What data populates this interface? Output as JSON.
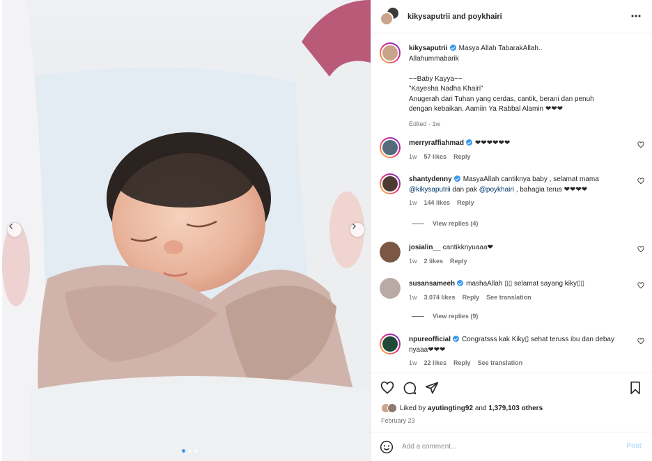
{
  "header": {
    "title": "kikysaputrii and poykhairi"
  },
  "caption": {
    "username": "kikysaputrii",
    "lines": [
      "Masya Allah TabarakAllah..",
      "Allahummabarik",
      "",
      "~~Baby Kayya~~",
      "\"Kayesha Nadha Khairi\"",
      "Anugerah dari Tuhan yang cerdas, cantik, berani dan penuh",
      "dengan kebaikan. Aamiin Ya Rabbal Alamin ❤❤❤"
    ],
    "edited": "Edited · 1w"
  },
  "comments": [
    {
      "username": "merryraffiahmad",
      "verified": true,
      "text": "❤❤❤❤❤❤",
      "time": "1w",
      "likes": "57 likes",
      "reply": "Reply"
    },
    {
      "username": "shantydenny",
      "verified": true,
      "text_1": "MasyaAllah cantiknya baby , selamat mama",
      "mention_1": "@kikysaputrii",
      "text_2": "dan pak",
      "mention_2": "@poykhairi",
      "text_3": ", bahagia terus ❤❤❤❤",
      "time": "1w",
      "likes": "144 likes",
      "reply": "Reply",
      "view_replies": "View replies (4)"
    },
    {
      "username": "josialin__",
      "verified": false,
      "text": "cantikknyuaaa❤",
      "time": "1w",
      "likes": "2 likes",
      "reply": "Reply"
    },
    {
      "username": "susansameeh",
      "verified": true,
      "text": "mashaAllah ▯▯ selamat sayang kiky▯▯",
      "time": "1w",
      "likes": "3.074 likes",
      "reply": "Reply",
      "translate": "See translation",
      "view_replies": "View replies (9)"
    },
    {
      "username": "npureofficial",
      "verified": true,
      "text": "Congratsss kak Kiky▯ sehat teruss ibu dan debay nyaaa❤❤❤",
      "time": "1w",
      "likes": "22 likes",
      "reply": "Reply",
      "translate": "See translation"
    }
  ],
  "likes": {
    "prefix": "Liked by",
    "user": "ayutingting92",
    "and": "and",
    "others": "1,379,103 others"
  },
  "date": "February 23",
  "comment_box": {
    "placeholder": "Add a comment...",
    "post": "Post"
  },
  "media": {
    "slides": 3,
    "active_slide": 1
  }
}
